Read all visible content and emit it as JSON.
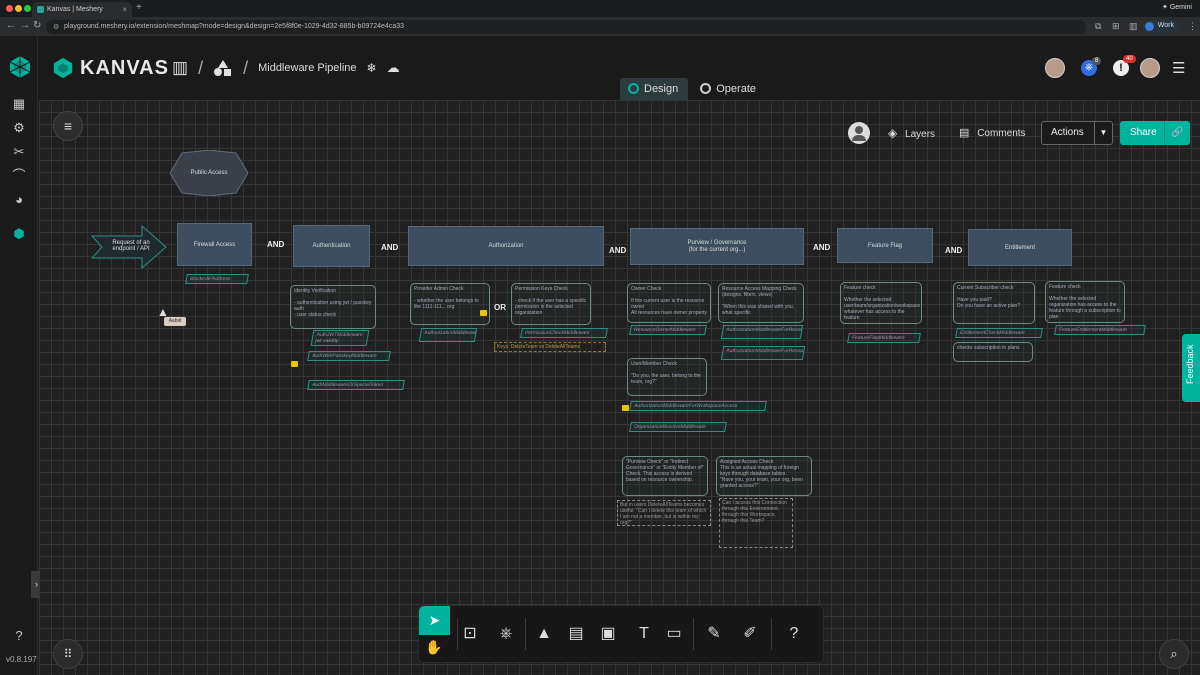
{
  "browser": {
    "tab_title": "Kanvas | Meshery",
    "url": "playground.meshery.io/extension/meshmap?mode=design&design=2e5f8f0e-1029-4d32-885b-b09724e4ca33",
    "gemini_label": "Gemini",
    "profile_label": "Work",
    "traffic_colors": [
      "#ff5f57",
      "#febc2e",
      "#28c840"
    ]
  },
  "app": {
    "brand": "KANVAS",
    "design_name": "Middleware Pipeline",
    "version": "v0.8.197",
    "accent_color": "#00b39f",
    "mode_tabs": [
      {
        "label": "Design",
        "active": true
      },
      {
        "label": "Operate",
        "active": false
      }
    ],
    "notifications": {
      "kubernetes_count": "8",
      "alerts_count": "40"
    }
  },
  "canvas_toolbar": {
    "layers_label": "Layers",
    "comments_label": "Comments",
    "actions_label": "Actions",
    "share_label": "Share"
  },
  "feedback_label": "Feedback",
  "cursor_tooltip": "Aabid",
  "diagram": {
    "public_access": "Public Access",
    "request": "Request of an endpoint / API",
    "stages": [
      {
        "label": "Firewall Access"
      },
      {
        "label": "Authentication"
      },
      {
        "label": "Authorization"
      },
      {
        "label": "Purview / Governance\n(for the current org...)"
      },
      {
        "label": "Feature Flag"
      },
      {
        "label": "Entitlement"
      }
    ],
    "and_label": "AND",
    "or_label": "OR",
    "blocked_ip": "BlockedIPAddress",
    "identity_note": "Identity Verification\n\n- authentication using jwt / passkey auth\n- user status check",
    "auth_jwt": "AuthJWTMiddleware\njwt validity",
    "auth_passkey": "AuthWithPasskeyMiddleware",
    "auth_special": "AuthMiddlewareOrSpecialToken",
    "provider_admin_note": "Provider Admin Check\n\n- whether the user belongs to the 1111-111... org",
    "authz_admin": "AuthorizationMiddlewareForAdmin",
    "permission_note": "Permission Keys Check\n\n- check if the user has a specific permission in the selected organization",
    "permission_mw": "PermissionCheckMiddleware",
    "keys_dotted": "Keys: DeleteTeam vs DeleteAllTeams",
    "owner_note": "Owner Check\n\nIf the current user is the resource owner\nAll resources have owner property",
    "owner_mw": "ResourceOwnerMiddleware",
    "resource_access_note": "Resource Access Mapping Check (designs, filters, views)\n\n\"When this was shared with you, what specific",
    "resource_access_mw": "AuthorizationMiddlewareForResourceAccess",
    "resource_access_mw2": "AuthorizationMiddlewareForResourceAccessById",
    "user_member_note": "User/Member Check\n\n\"Do you, the user, belong to the team, org?\"",
    "workspace_mw": "AuthorizationMiddlewareForWorkspaceAccess",
    "org_resolve_mw": "OrganizationResolveMiddleware",
    "purview_note": "\"Purview Check\" or \"Indirect Governance\" or \"Entity Member of\" Check. This access is derived based on resource ownership.",
    "purview_dotted": "But in users DeleteAllTeams becomes useful: \"Can I delete this team of which I am not a member, but is within my org?\"",
    "assigned_note": "Assigned Access Check\nThis is an actual mapping of foreign keys through database tables.\n\"Have you, your team, your org, been granted access?\"",
    "assigned_dotted": "Can I access this Connection through this Environment, through this Workspace, through this Team?",
    "feature_check_note": "Feature check\n\nWhether the selected user/team/organization/workspace whatever has access to the feature",
    "feature_flag_mw": "FeatureFlagMiddleware",
    "subscriber_note": "Current Subscriber check\n\nHave you paid?\nDo you have an active plan?",
    "entitlement_mw": "EntitlementCheckMiddleware",
    "subscription_note": "checks subscription to plans",
    "entitlement_feature_note": "Feature check\n\nWhether the selected organization has access to the feature through a subscription to plan",
    "feature_entitlement_mw": "FeatureEntitlementMiddleware"
  }
}
